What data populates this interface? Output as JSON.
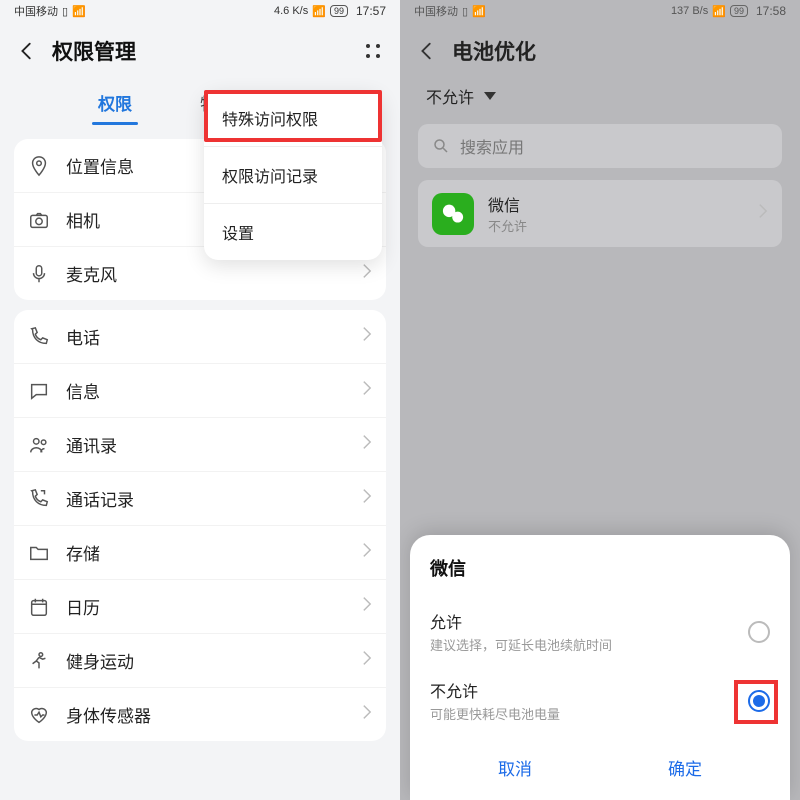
{
  "left": {
    "statusbar": {
      "carrier": "中国移动",
      "netspeed": "4.6 K/s",
      "battery": "99",
      "time": "17:57"
    },
    "header_title": "权限管理",
    "tabs": {
      "permissions": "权限",
      "special": "特殊访问权限"
    },
    "popover": {
      "special": "特殊访问权限",
      "history": "权限访问记录",
      "settings": "设置"
    },
    "rows": {
      "location": "位置信息",
      "camera": "相机",
      "microphone": "麦克风",
      "phone": "电话",
      "sms": "信息",
      "contacts": "通讯录",
      "calllog": "通话记录",
      "storage": "存储",
      "calendar": "日历",
      "fitness": "健身运动",
      "sensors": "身体传感器"
    }
  },
  "right": {
    "statusbar": {
      "carrier": "中国移动",
      "netspeed": "137 B/s",
      "battery": "99",
      "time": "17:58"
    },
    "header_title": "电池优化",
    "filter_label": "不允许",
    "search_placeholder": "搜索应用",
    "app": {
      "name": "微信",
      "status": "不允许"
    },
    "sheet": {
      "title": "微信",
      "option_allow": {
        "title": "允许",
        "sub": "建议选择，可延长电池续航时间"
      },
      "option_deny": {
        "title": "不允许",
        "sub": "可能更快耗尽电池电量"
      },
      "cancel": "取消",
      "confirm": "确定"
    }
  }
}
